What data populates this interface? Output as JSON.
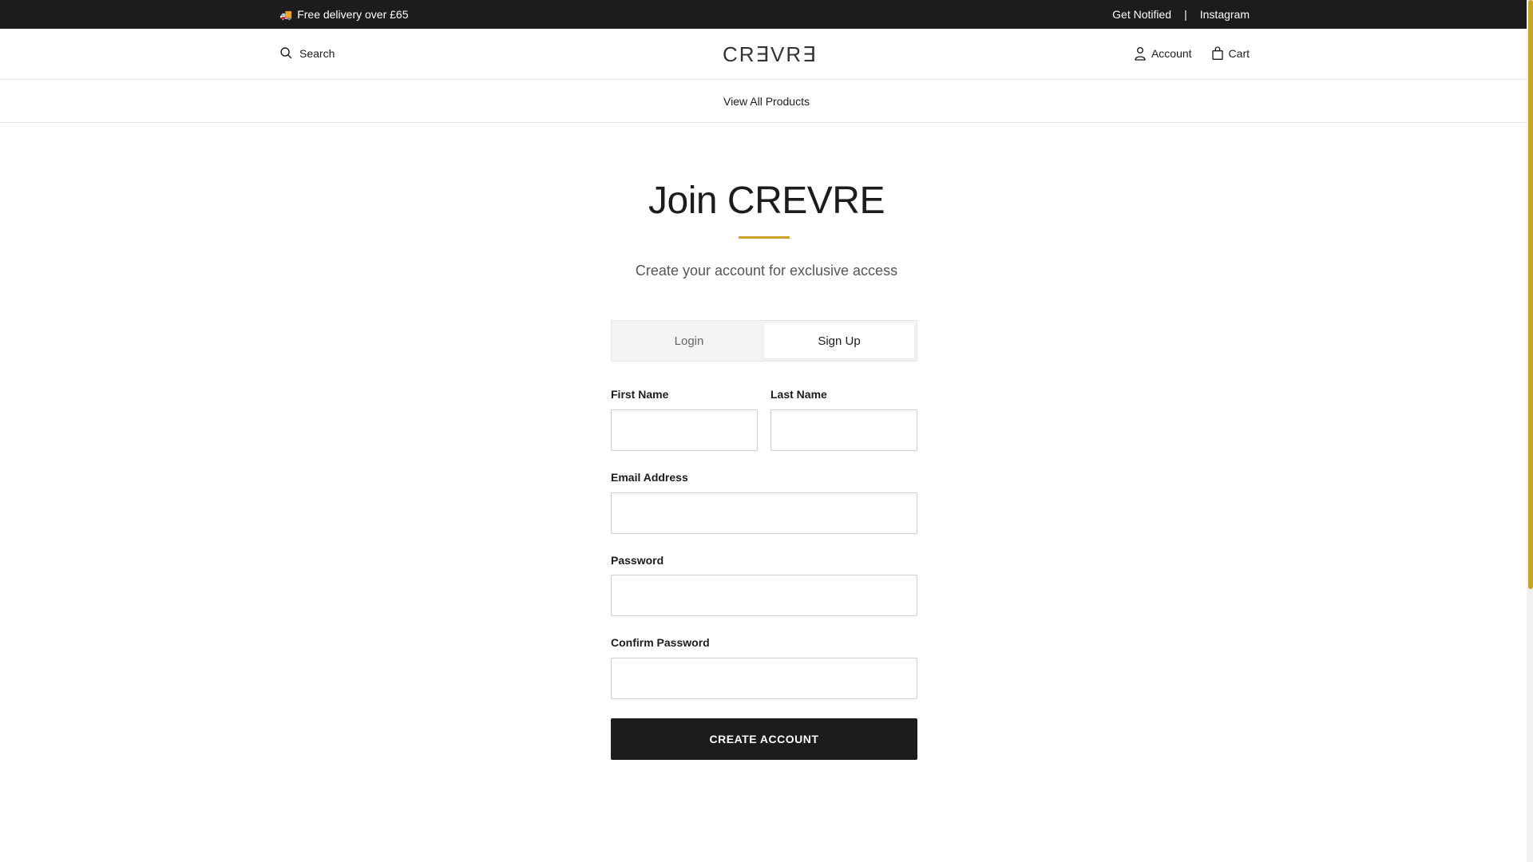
{
  "topbar": {
    "delivery_text": "Free delivery over £65",
    "get_notified": "Get Notified",
    "separator": "|",
    "instagram": "Instagram"
  },
  "header": {
    "search_label": "Search",
    "logo_text": "CR∃VR∃",
    "account_label": "Account",
    "cart_label": "Cart"
  },
  "nav": {
    "view_all": "View All Products"
  },
  "page": {
    "title": "Join CREVRE",
    "subtitle": "Create your account for exclusive access"
  },
  "tabs": {
    "login": "Login",
    "signup": "Sign Up",
    "active": "signup"
  },
  "form": {
    "first_name_label": "First Name",
    "last_name_label": "Last Name",
    "email_label": "Email Address",
    "password_label": "Password",
    "confirm_password_label": "Confirm Password",
    "first_name_value": "",
    "last_name_value": "",
    "email_value": "",
    "password_value": "",
    "confirm_password_value": "",
    "submit_label": "CREATE ACCOUNT"
  },
  "colors": {
    "accent": "#c9a227",
    "dark": "#1c1c1c"
  }
}
